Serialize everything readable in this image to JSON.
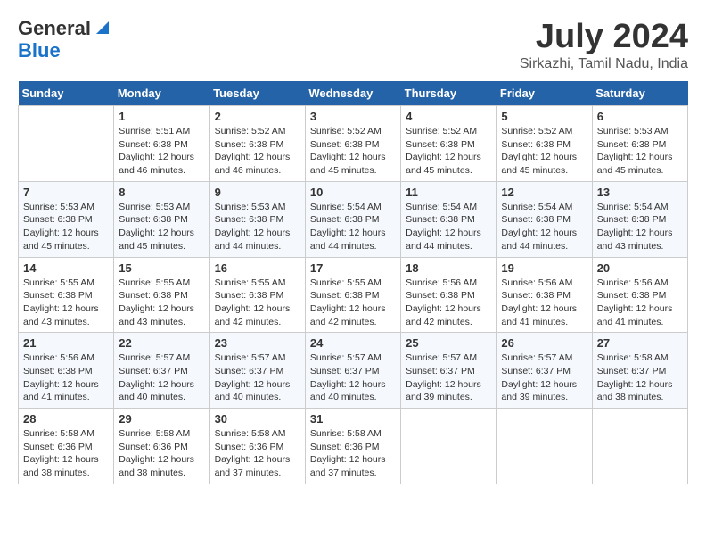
{
  "header": {
    "logo_line1": "General",
    "logo_line2": "Blue",
    "month": "July 2024",
    "location": "Sirkazhi, Tamil Nadu, India"
  },
  "weekdays": [
    "Sunday",
    "Monday",
    "Tuesday",
    "Wednesday",
    "Thursday",
    "Friday",
    "Saturday"
  ],
  "weeks": [
    [
      {
        "day": "",
        "sunrise": "",
        "sunset": "",
        "daylight": ""
      },
      {
        "day": "1",
        "sunrise": "Sunrise: 5:51 AM",
        "sunset": "Sunset: 6:38 PM",
        "daylight": "Daylight: 12 hours and 46 minutes."
      },
      {
        "day": "2",
        "sunrise": "Sunrise: 5:52 AM",
        "sunset": "Sunset: 6:38 PM",
        "daylight": "Daylight: 12 hours and 46 minutes."
      },
      {
        "day": "3",
        "sunrise": "Sunrise: 5:52 AM",
        "sunset": "Sunset: 6:38 PM",
        "daylight": "Daylight: 12 hours and 45 minutes."
      },
      {
        "day": "4",
        "sunrise": "Sunrise: 5:52 AM",
        "sunset": "Sunset: 6:38 PM",
        "daylight": "Daylight: 12 hours and 45 minutes."
      },
      {
        "day": "5",
        "sunrise": "Sunrise: 5:52 AM",
        "sunset": "Sunset: 6:38 PM",
        "daylight": "Daylight: 12 hours and 45 minutes."
      },
      {
        "day": "6",
        "sunrise": "Sunrise: 5:53 AM",
        "sunset": "Sunset: 6:38 PM",
        "daylight": "Daylight: 12 hours and 45 minutes."
      }
    ],
    [
      {
        "day": "7",
        "sunrise": "Sunrise: 5:53 AM",
        "sunset": "Sunset: 6:38 PM",
        "daylight": "Daylight: 12 hours and 45 minutes."
      },
      {
        "day": "8",
        "sunrise": "Sunrise: 5:53 AM",
        "sunset": "Sunset: 6:38 PM",
        "daylight": "Daylight: 12 hours and 45 minutes."
      },
      {
        "day": "9",
        "sunrise": "Sunrise: 5:53 AM",
        "sunset": "Sunset: 6:38 PM",
        "daylight": "Daylight: 12 hours and 44 minutes."
      },
      {
        "day": "10",
        "sunrise": "Sunrise: 5:54 AM",
        "sunset": "Sunset: 6:38 PM",
        "daylight": "Daylight: 12 hours and 44 minutes."
      },
      {
        "day": "11",
        "sunrise": "Sunrise: 5:54 AM",
        "sunset": "Sunset: 6:38 PM",
        "daylight": "Daylight: 12 hours and 44 minutes."
      },
      {
        "day": "12",
        "sunrise": "Sunrise: 5:54 AM",
        "sunset": "Sunset: 6:38 PM",
        "daylight": "Daylight: 12 hours and 44 minutes."
      },
      {
        "day": "13",
        "sunrise": "Sunrise: 5:54 AM",
        "sunset": "Sunset: 6:38 PM",
        "daylight": "Daylight: 12 hours and 43 minutes."
      }
    ],
    [
      {
        "day": "14",
        "sunrise": "Sunrise: 5:55 AM",
        "sunset": "Sunset: 6:38 PM",
        "daylight": "Daylight: 12 hours and 43 minutes."
      },
      {
        "day": "15",
        "sunrise": "Sunrise: 5:55 AM",
        "sunset": "Sunset: 6:38 PM",
        "daylight": "Daylight: 12 hours and 43 minutes."
      },
      {
        "day": "16",
        "sunrise": "Sunrise: 5:55 AM",
        "sunset": "Sunset: 6:38 PM",
        "daylight": "Daylight: 12 hours and 42 minutes."
      },
      {
        "day": "17",
        "sunrise": "Sunrise: 5:55 AM",
        "sunset": "Sunset: 6:38 PM",
        "daylight": "Daylight: 12 hours and 42 minutes."
      },
      {
        "day": "18",
        "sunrise": "Sunrise: 5:56 AM",
        "sunset": "Sunset: 6:38 PM",
        "daylight": "Daylight: 12 hours and 42 minutes."
      },
      {
        "day": "19",
        "sunrise": "Sunrise: 5:56 AM",
        "sunset": "Sunset: 6:38 PM",
        "daylight": "Daylight: 12 hours and 41 minutes."
      },
      {
        "day": "20",
        "sunrise": "Sunrise: 5:56 AM",
        "sunset": "Sunset: 6:38 PM",
        "daylight": "Daylight: 12 hours and 41 minutes."
      }
    ],
    [
      {
        "day": "21",
        "sunrise": "Sunrise: 5:56 AM",
        "sunset": "Sunset: 6:38 PM",
        "daylight": "Daylight: 12 hours and 41 minutes."
      },
      {
        "day": "22",
        "sunrise": "Sunrise: 5:57 AM",
        "sunset": "Sunset: 6:37 PM",
        "daylight": "Daylight: 12 hours and 40 minutes."
      },
      {
        "day": "23",
        "sunrise": "Sunrise: 5:57 AM",
        "sunset": "Sunset: 6:37 PM",
        "daylight": "Daylight: 12 hours and 40 minutes."
      },
      {
        "day": "24",
        "sunrise": "Sunrise: 5:57 AM",
        "sunset": "Sunset: 6:37 PM",
        "daylight": "Daylight: 12 hours and 40 minutes."
      },
      {
        "day": "25",
        "sunrise": "Sunrise: 5:57 AM",
        "sunset": "Sunset: 6:37 PM",
        "daylight": "Daylight: 12 hours and 39 minutes."
      },
      {
        "day": "26",
        "sunrise": "Sunrise: 5:57 AM",
        "sunset": "Sunset: 6:37 PM",
        "daylight": "Daylight: 12 hours and 39 minutes."
      },
      {
        "day": "27",
        "sunrise": "Sunrise: 5:58 AM",
        "sunset": "Sunset: 6:37 PM",
        "daylight": "Daylight: 12 hours and 38 minutes."
      }
    ],
    [
      {
        "day": "28",
        "sunrise": "Sunrise: 5:58 AM",
        "sunset": "Sunset: 6:36 PM",
        "daylight": "Daylight: 12 hours and 38 minutes."
      },
      {
        "day": "29",
        "sunrise": "Sunrise: 5:58 AM",
        "sunset": "Sunset: 6:36 PM",
        "daylight": "Daylight: 12 hours and 38 minutes."
      },
      {
        "day": "30",
        "sunrise": "Sunrise: 5:58 AM",
        "sunset": "Sunset: 6:36 PM",
        "daylight": "Daylight: 12 hours and 37 minutes."
      },
      {
        "day": "31",
        "sunrise": "Sunrise: 5:58 AM",
        "sunset": "Sunset: 6:36 PM",
        "daylight": "Daylight: 12 hours and 37 minutes."
      },
      {
        "day": "",
        "sunrise": "",
        "sunset": "",
        "daylight": ""
      },
      {
        "day": "",
        "sunrise": "",
        "sunset": "",
        "daylight": ""
      },
      {
        "day": "",
        "sunrise": "",
        "sunset": "",
        "daylight": ""
      }
    ]
  ]
}
